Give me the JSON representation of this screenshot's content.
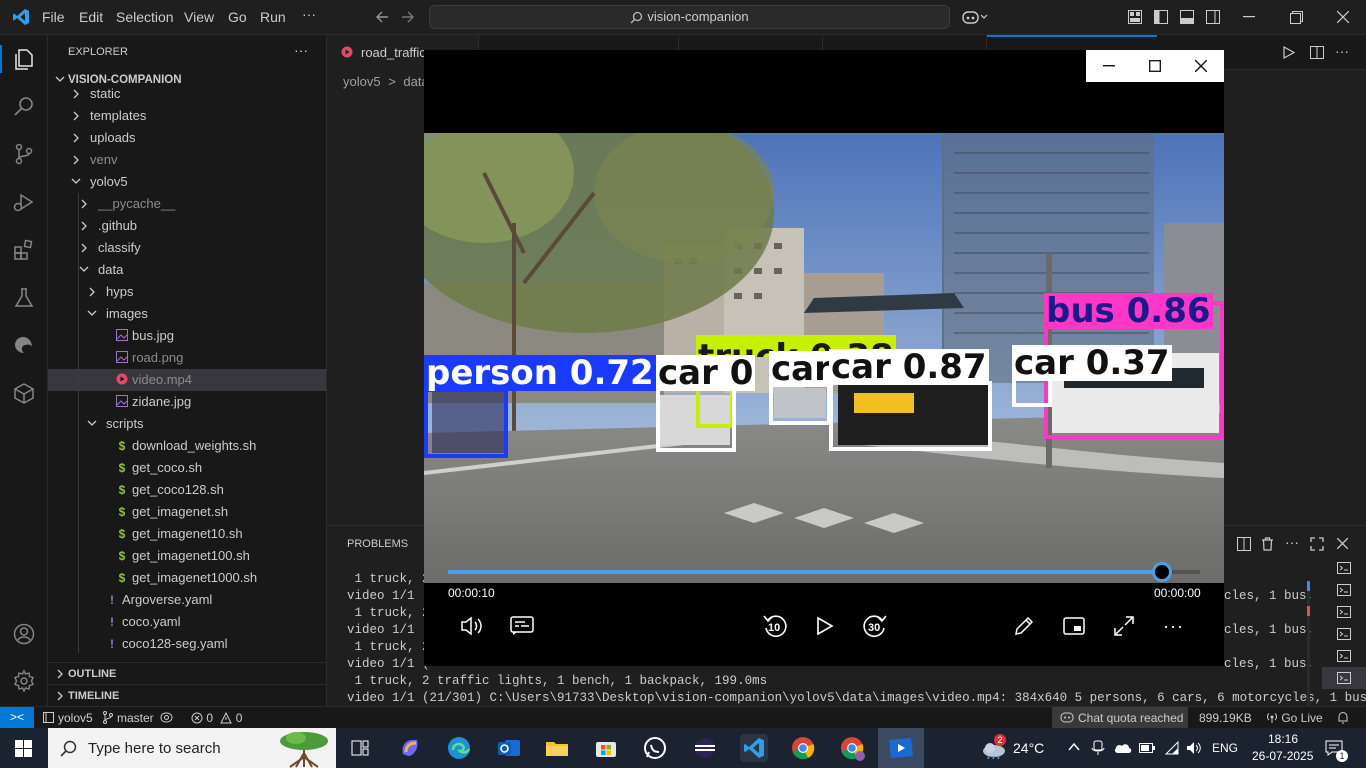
{
  "titlebar": {
    "menus": [
      "File",
      "Edit",
      "Selection",
      "View",
      "Go",
      "Run"
    ],
    "more": "···",
    "search_text": "vision-companion"
  },
  "explorer": {
    "header": "EXPLORER",
    "more": "···",
    "root": "VISION-COMPANION",
    "items": [
      {
        "label": "static"
      },
      {
        "label": "templates"
      },
      {
        "label": "uploads"
      },
      {
        "label": "venv"
      },
      {
        "label": "yolov5"
      },
      {
        "label": "__pycache__"
      },
      {
        "label": ".github"
      },
      {
        "label": "classify"
      },
      {
        "label": "data"
      },
      {
        "label": "hyps"
      },
      {
        "label": "images"
      },
      {
        "label": "bus.jpg"
      },
      {
        "label": "road.png"
      },
      {
        "label": "video.mp4"
      },
      {
        "label": "zidane.jpg"
      },
      {
        "label": "scripts"
      },
      {
        "label": "download_weights.sh"
      },
      {
        "label": "get_coco.sh"
      },
      {
        "label": "get_coco128.sh"
      },
      {
        "label": "get_imagenet.sh"
      },
      {
        "label": "get_imagenet10.sh"
      },
      {
        "label": "get_imagenet100.sh"
      },
      {
        "label": "get_imagenet1000.sh"
      },
      {
        "label": "Argoverse.yaml"
      },
      {
        "label": "coco.yaml"
      },
      {
        "label": "coco128-seg.yaml"
      }
    ],
    "outline": "OUTLINE",
    "timeline": "TIMELINE"
  },
  "editor": {
    "tab_label": "road_traffic",
    "breadcrumb_root": "yolov5",
    "breadcrumb_sep": ">",
    "breadcrumb_next": "data"
  },
  "panel": {
    "problems": "PROBLEMS",
    "lines": [
      " 1 truck, 2",
      "video 1/1 (",
      " 1 truck, 2",
      "video 1/1 (",
      " 1 truck, 2",
      "video 1/1 (",
      " 1 truck, 2 traffic lights, 1 bench, 1 backpack, 199.0ms",
      "video 1/1 (21/301) C:\\Users\\91733\\Desktop\\vision-companion\\yolov5\\data\\images\\video.mp4: 384x640 5 persons, 6 cars, 6 motorcycles, 1 bus,"
    ],
    "right_tail": "cles, 1 bus,"
  },
  "statusbar": {
    "remote": "><",
    "branch_root": "yolov5",
    "branch": "master",
    "errors": "0",
    "warnings": "0",
    "chat": "Chat quota reached",
    "size": "899.19KB",
    "golive": "Go Live"
  },
  "video": {
    "current_time": "00:00:10",
    "total_time": "00:00:00",
    "progress": 0.95,
    "rewind_label": "10",
    "forward_label": "30",
    "detections": [
      "bus 0.86",
      "truck 0.38",
      "person 0.72",
      "car 0",
      "car",
      "car 0.87",
      "car 0.37"
    ]
  },
  "taskbar": {
    "search_placeholder": "Type here to search",
    "temperature": "24°C",
    "language": "ENG",
    "time": "18:16",
    "date": "26-07-2025",
    "notif_badge": "2",
    "notif_count": "1"
  },
  "colors": {
    "accent": "#0078d4",
    "bus": "#ff37c7",
    "person": "#1a3bff",
    "truck": "#c6f000",
    "car": "#ffffff"
  }
}
